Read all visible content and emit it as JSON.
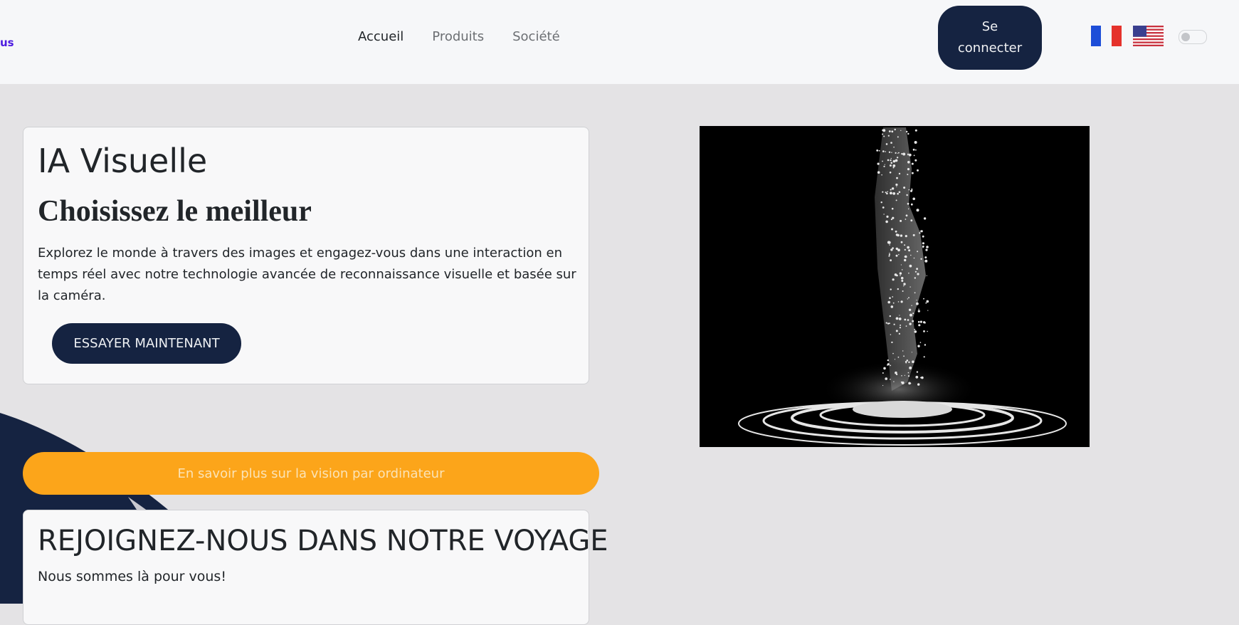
{
  "navbar": {
    "brand_fragment": "us",
    "links": [
      {
        "label": "Accueil",
        "active": true
      },
      {
        "label": "Produits",
        "active": false
      },
      {
        "label": "Société",
        "active": false
      }
    ],
    "login_label": "Se\nconnecter",
    "languages": [
      {
        "icon": "france-flag-icon",
        "code": "fr"
      },
      {
        "icon": "usa-flag-icon",
        "code": "en"
      }
    ],
    "theme_toggle": {
      "icon": "toggle-switch",
      "on": false
    }
  },
  "hero": {
    "title": "IA Visuelle",
    "subtitle": "Choisissez le meilleur",
    "description": "Explorez le monde à travers des images et engagez-vous dans une interaction en temps réel avec notre technologie avancée de reconnaissance visuelle et basée sur la caméra.",
    "cta_label": "ESSAYER MAINTENANT",
    "image_icon": "particle-face-hologram-image"
  },
  "learn_more_label": "En savoir plus sur la vision par ordinateur",
  "join": {
    "title": "REJOIGNEZ-NOUS DANS NOTRE VOYAGE",
    "subtitle": "Nous sommes là pour vous!"
  },
  "colors": {
    "primary_dark": "#152341",
    "accent_orange": "#fca51a",
    "page_bg": "#e4e3e5",
    "navbar_bg": "#f6f7f9",
    "brand_purple": "#4c1be0"
  }
}
